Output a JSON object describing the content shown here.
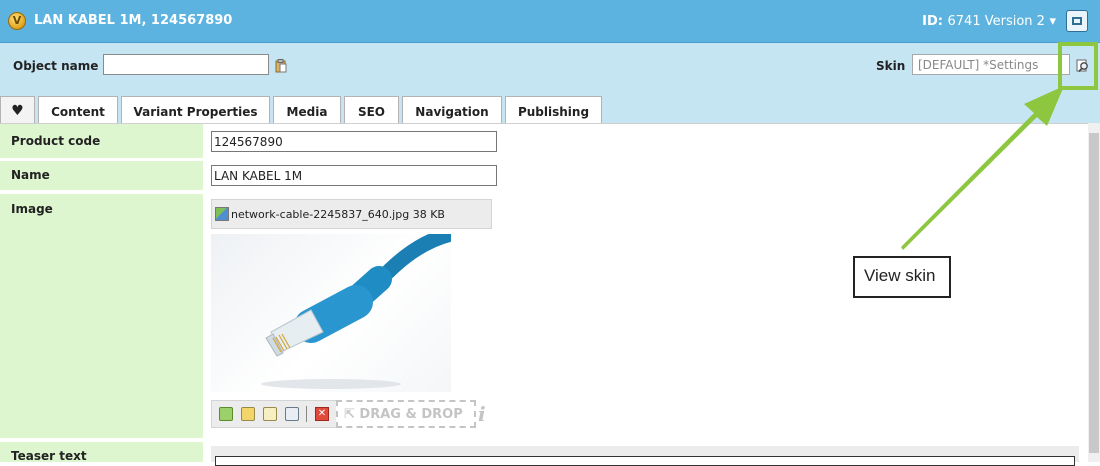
{
  "window": {
    "title": "LAN KABEL 1M, 124567890",
    "id_label": "ID:",
    "id_value": "6741 Version 2",
    "dropdown_glyph": "▾"
  },
  "toolbar": {
    "object_name_label": "Object name",
    "object_name_value": "",
    "skin_label": "Skin",
    "skin_value": "[DEFAULT] *Settings"
  },
  "tabs": [
    {
      "label": "♥",
      "icon": "heart-icon"
    },
    {
      "label": "Content"
    },
    {
      "label": "Variant Properties"
    },
    {
      "label": "Media"
    },
    {
      "label": "SEO"
    },
    {
      "label": "Navigation"
    },
    {
      "label": "Publishing"
    }
  ],
  "fields": {
    "product_code": {
      "label": "Product code",
      "value": "124567890"
    },
    "name": {
      "label": "Name",
      "value": "LAN KABEL 1M"
    },
    "image": {
      "label": "Image",
      "file": "network-cable-2245837_640.jpg 38 KB"
    },
    "teaser": {
      "label": "Teaser text"
    }
  },
  "image_toolbar": {
    "drag_drop": "⇱ DRAG & DROP",
    "info": "i",
    "delete_glyph": "✕"
  },
  "annotation": {
    "callout": "View skin",
    "color": "#8dc63f"
  }
}
